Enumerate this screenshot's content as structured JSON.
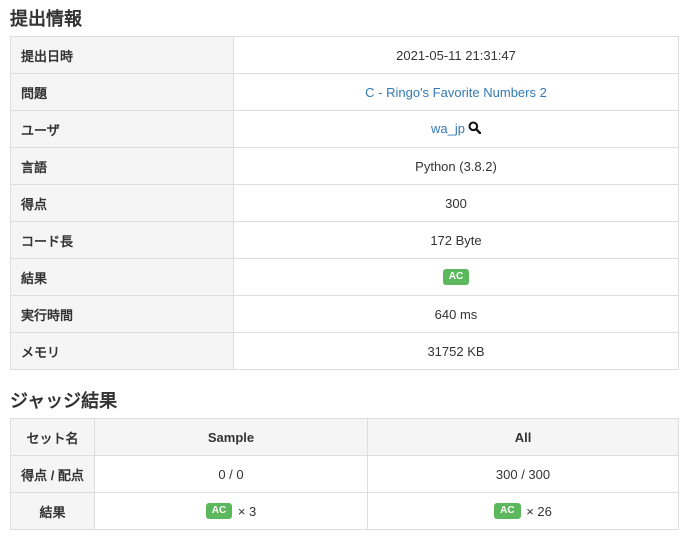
{
  "info": {
    "heading": "提出情報",
    "rows": {
      "submitted_at": {
        "label": "提出日時",
        "value": "2021-05-11 21:31:47"
      },
      "task": {
        "label": "問題",
        "value": "C - Ringo's Favorite Numbers 2"
      },
      "user": {
        "label": "ユーザ",
        "value": "wa_jp"
      },
      "language": {
        "label": "言語",
        "value": "Python (3.8.2)"
      },
      "score": {
        "label": "得点",
        "value": "300"
      },
      "code_length": {
        "label": "コード長",
        "value": "172 Byte"
      },
      "result": {
        "label": "結果",
        "value": "AC"
      },
      "exec_time": {
        "label": "実行時間",
        "value": "640 ms"
      },
      "memory": {
        "label": "メモリ",
        "value": "31752 KB"
      }
    }
  },
  "judge": {
    "heading": "ジャッジ結果",
    "headers": {
      "set_name": "セット名",
      "sample": "Sample",
      "all": "All"
    },
    "score_row": {
      "label": "得点 / 配点",
      "sample": "0 / 0",
      "all": "300 / 300"
    },
    "result_row": {
      "label": "結果",
      "sample_badge": "AC",
      "sample_count": "× 3",
      "all_badge": "AC",
      "all_count": "× 26"
    }
  },
  "colors": {
    "accent": "#5cb85c",
    "link": "#337ab7"
  },
  "icons": {
    "user_search": "search-icon"
  }
}
